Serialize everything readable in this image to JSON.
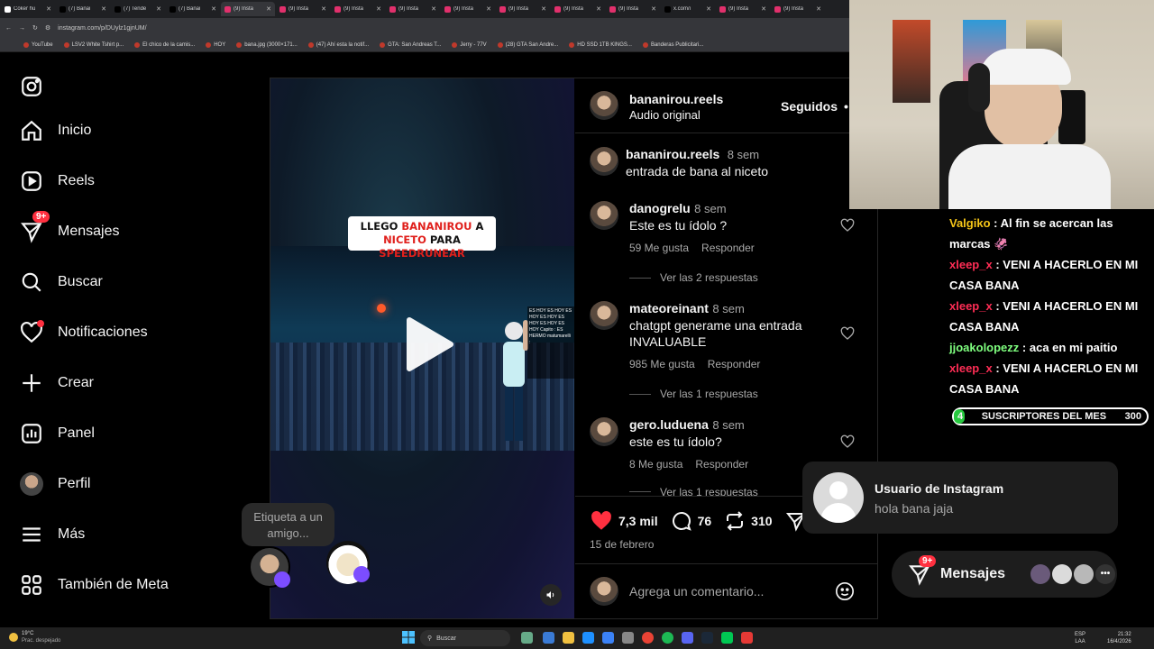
{
  "browser": {
    "tabs": [
      {
        "label": "Coker hu",
        "color": "#ffffff"
      },
      {
        "label": "(7) Banai",
        "color": "#000000"
      },
      {
        "label": "(7) Tende",
        "color": "#000000"
      },
      {
        "label": "(7) Banai",
        "color": "#000000"
      },
      {
        "label": "(9) Insta",
        "color": "#e1306c",
        "active": true
      },
      {
        "label": "(9) Insta",
        "color": "#e1306c"
      },
      {
        "label": "(9) Insta",
        "color": "#e1306c"
      },
      {
        "label": "(9) Insta",
        "color": "#e1306c"
      },
      {
        "label": "(9) Insta",
        "color": "#e1306c"
      },
      {
        "label": "(9) Insta",
        "color": "#e1306c"
      },
      {
        "label": "(9) Insta",
        "color": "#e1306c"
      },
      {
        "label": "(9) Insta",
        "color": "#e1306c"
      },
      {
        "label": "x.com/i",
        "color": "#000000"
      },
      {
        "label": "(9) Insta",
        "color": "#e1306c"
      },
      {
        "label": "(9) Insta",
        "color": "#e1306c"
      }
    ],
    "url": "instagram.com/p/DUylz1gjnUM/",
    "bookmarks": [
      "YouTube",
      "LSV2 White Tshirt p...",
      "El chico de la camis...",
      "HOY",
      "bana.jpg (3000×171...",
      "(47) Ahí esta la notif...",
      "GTA: San Andreas T...",
      "Jerry - 77V",
      "(28) GTA San Andre...",
      "HD SSD 1TB KINGS...",
      "Banderas Publicitari..."
    ]
  },
  "sidebar": {
    "logo_icon": "instagram-logo-icon",
    "items": [
      {
        "label": "Inicio",
        "icon": "home-icon"
      },
      {
        "label": "Reels",
        "icon": "reels-icon"
      },
      {
        "label": "Mensajes",
        "icon": "messenger-icon",
        "badge": "9+"
      },
      {
        "label": "Buscar",
        "icon": "search-icon"
      },
      {
        "label": "Notificaciones",
        "icon": "heart-icon"
      },
      {
        "label": "Crear",
        "icon": "plus-icon"
      },
      {
        "label": "Panel",
        "icon": "chart-icon"
      },
      {
        "label": "Perfil",
        "icon": "avatar"
      },
      {
        "label": "Más",
        "icon": "menu-icon"
      },
      {
        "label": "También de Meta",
        "icon": "meta-icon"
      }
    ]
  },
  "video": {
    "caption_line1_a": "LLEGO ",
    "caption_line1_b": "BANANIROU",
    "caption_line1_c": " A",
    "caption_line2_a": "NICETO",
    "caption_line2_b": " PARA ",
    "caption_line2_c": "SPEEDRUNEAR",
    "overlay_text": "ES HOY ES HOY ES HOY ES HOY ES HOY ES HOY ES HOY Capito : ES HERMO matumarelli :",
    "tag_prompt": "Etiqueta a un amigo..."
  },
  "post": {
    "author": "bananirou.reels",
    "audio": "Audio original",
    "follow_label": "Seguidos",
    "caption": {
      "user": "bananirou.reels",
      "time": "8 sem",
      "text": "entrada de bana al niceto"
    },
    "comments": [
      {
        "user": "danogrelu",
        "time": "8 sem",
        "text": "Este es tu ídolo ?",
        "likes": "59 Me gusta",
        "reply": "Responder",
        "replies": "Ver las 2 respuestas"
      },
      {
        "user": "mateoreinant",
        "time": "8 sem",
        "text": "chatgpt generame una entrada INVALUABLE",
        "likes": "985 Me gusta",
        "reply": "Responder",
        "replies": "Ver las 1 respuestas"
      },
      {
        "user": "gero.luduena",
        "time": "8 sem",
        "text": "este es tu ídolo?",
        "likes": "8 Me gusta",
        "reply": "Responder",
        "replies": "Ver las 1 respuestas"
      }
    ],
    "like_count": "7,3 mil",
    "comment_count": "76",
    "repost_count": "310",
    "date": "15 de febrero",
    "comment_placeholder": "Agrega un comentario..."
  },
  "stream_chat": [
    {
      "user": "Valgiko",
      "color": "#f5c518",
      "text": ": Al fin se acercan las marcas 🦑"
    },
    {
      "user": "xleep_x",
      "color": "#ff2d55",
      "text": ": VENI A HACERLO EN MI CASA BANA"
    },
    {
      "user": "xleep_x",
      "color": "#ff2d55",
      "text": ": VENI A HACERLO EN MI CASA BANA"
    },
    {
      "user": "jjoakolopezz",
      "color": "#7fff7f",
      "text": ": aca en mi paitio"
    },
    {
      "user": "xleep_x",
      "color": "#ff2d55",
      "text": ": VENI A HACERLO EN MI CASA BANA"
    }
  ],
  "subs_bar": {
    "current": "4",
    "label": "SUSCRIPTORES DEL MES",
    "goal": "300",
    "progress": 0.013
  },
  "notification": {
    "title": "Usuario de Instagram",
    "message": "hola bana jaja"
  },
  "messages_pill": {
    "label": "Mensajes",
    "badge": "9+"
  },
  "taskbar": {
    "weather_temp": "19°C",
    "weather_desc": "Prac. despejado",
    "search_label": "Buscar",
    "lang": "ESP",
    "lang2": "LAA",
    "time": "21:32",
    "date": "16/4/2026"
  },
  "colors": {
    "like_red": "#ff3040",
    "accent_blue": "#0095f6"
  }
}
